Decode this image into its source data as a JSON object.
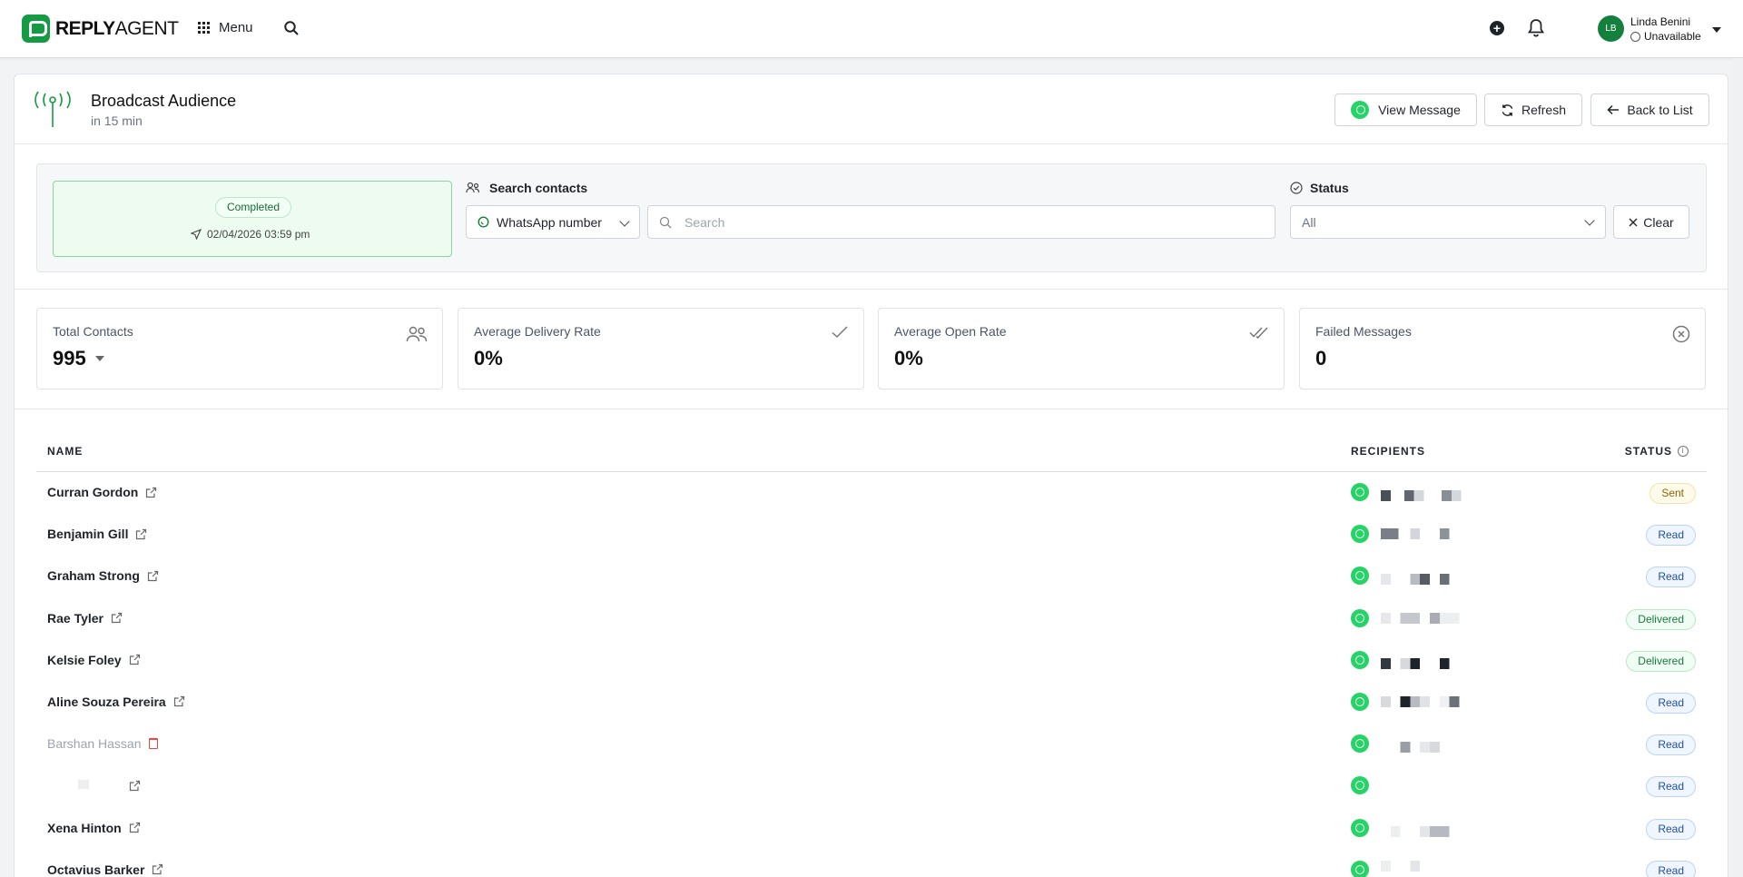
{
  "brand": {
    "bold": "REPLY",
    "light": "AGENT"
  },
  "topbar": {
    "menu_label": "Menu",
    "user_initials": "LB",
    "user_name": "Linda Benini",
    "user_status": "Unavailable"
  },
  "header": {
    "title": "Broadcast Audience",
    "subtitle": "in 15 min",
    "view_message_label": "View Message",
    "refresh_label": "Refresh",
    "back_label": "Back to List"
  },
  "filters": {
    "broadcast_status": "Completed",
    "sent_at": "02/04/2026 03:59 pm",
    "search_label": "Search contacts",
    "search_field": "WhatsApp number",
    "search_placeholder": "Search",
    "status_label": "Status",
    "status_value": "All",
    "clear_label": "Clear"
  },
  "stats": [
    {
      "label": "Total Contacts",
      "value": "995"
    },
    {
      "label": "Average Delivery Rate",
      "value": "0%"
    },
    {
      "label": "Average Open Rate",
      "value": "0%"
    },
    {
      "label": "Failed Messages",
      "value": "0"
    }
  ],
  "table": {
    "columns": {
      "name": "NAME",
      "recipients": "RECIPIENTS",
      "status": "STATUS"
    },
    "rows": [
      {
        "name": "Curran Gordon",
        "status": "Sent"
      },
      {
        "name": "Benjamin Gill",
        "status": "Read"
      },
      {
        "name": "Graham Strong",
        "status": "Read"
      },
      {
        "name": "Rae Tyler",
        "status": "Delivered"
      },
      {
        "name": "Kelsie Foley",
        "status": "Delivered"
      },
      {
        "name": "Aline Souza Pereira",
        "status": "Read"
      },
      {
        "name": "Barshan Hassan",
        "status": "Read"
      },
      {
        "name": "",
        "status": "Read"
      },
      {
        "name": "Xena Hinton",
        "status": "Read"
      },
      {
        "name": "Octavius Barker",
        "status": "Read"
      }
    ]
  },
  "colors": {
    "brand": "#169b45",
    "whatsapp": "#25d366",
    "completed_bg": "#edfbf1"
  }
}
